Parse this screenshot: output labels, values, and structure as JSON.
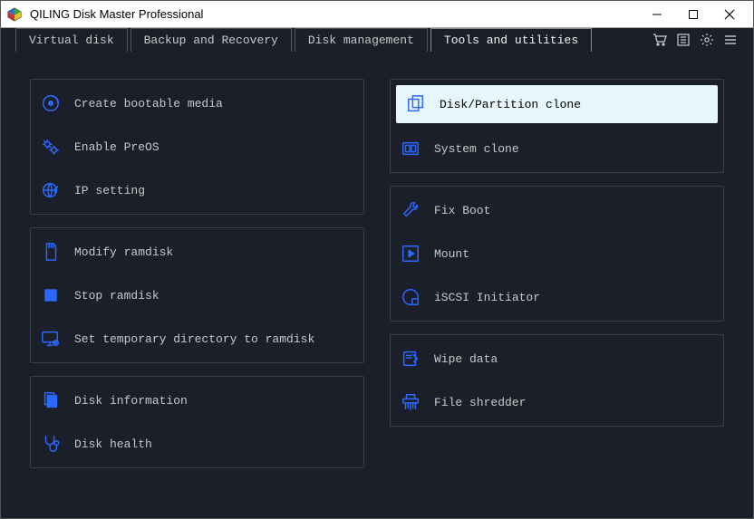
{
  "title": "QILING Disk Master Professional",
  "tabs": [
    {
      "label": "Virtual disk"
    },
    {
      "label": "Backup and Recovery"
    },
    {
      "label": "Disk management"
    },
    {
      "label": "Tools and utilities"
    }
  ],
  "activeTab": 3,
  "leftPanels": [
    {
      "items": [
        {
          "icon": "disc-icon",
          "label": "Create bootable media"
        },
        {
          "icon": "gears-icon",
          "label": "Enable PreOS"
        },
        {
          "icon": "globe-icon",
          "label": "IP setting"
        }
      ]
    },
    {
      "items": [
        {
          "icon": "sdcard-icon",
          "label": "Modify ramdisk"
        },
        {
          "icon": "stop-icon",
          "label": "Stop ramdisk"
        },
        {
          "icon": "monitor-gear-icon",
          "label": "Set temporary directory to ramdisk"
        }
      ]
    },
    {
      "items": [
        {
          "icon": "pages-icon",
          "label": "Disk information"
        },
        {
          "icon": "stethoscope-icon",
          "label": "Disk health"
        }
      ]
    }
  ],
  "rightPanels": [
    {
      "items": [
        {
          "icon": "clone-icon",
          "label": "Disk/Partition clone",
          "selected": true
        },
        {
          "icon": "system-clone-icon",
          "label": "System clone"
        }
      ]
    },
    {
      "items": [
        {
          "icon": "wrench-icon",
          "label": "Fix Boot"
        },
        {
          "icon": "play-icon",
          "label": "Mount"
        },
        {
          "icon": "iscsi-icon",
          "label": "iSCSI Initiator"
        }
      ]
    },
    {
      "items": [
        {
          "icon": "wipe-icon",
          "label": "Wipe data"
        },
        {
          "icon": "shredder-icon",
          "label": "File shredder"
        }
      ]
    }
  ]
}
